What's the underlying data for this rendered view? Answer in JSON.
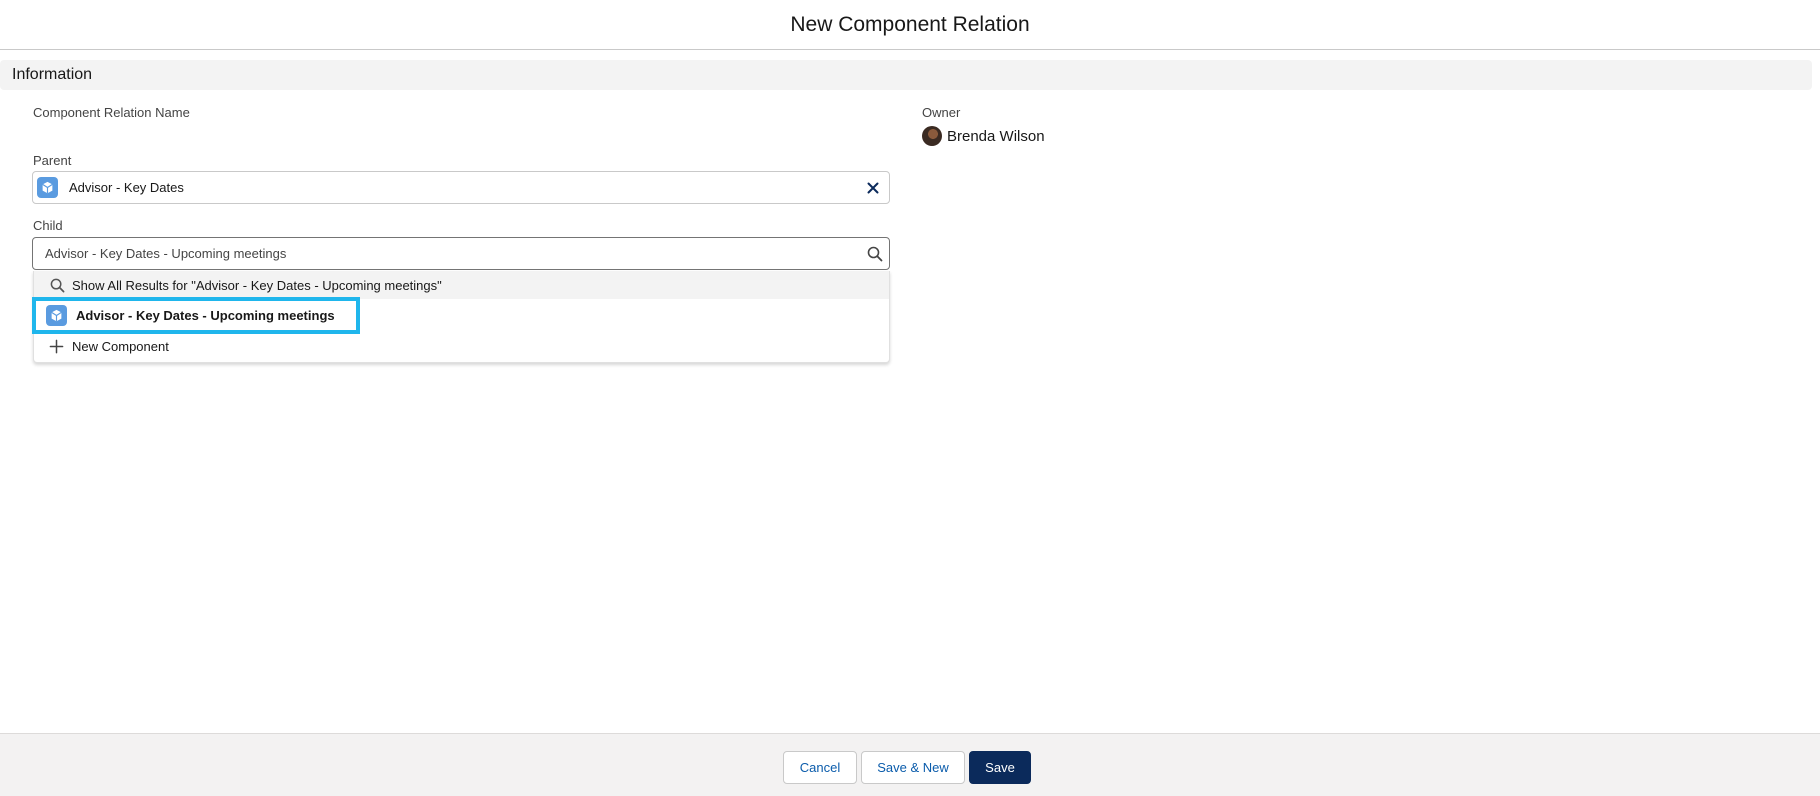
{
  "modal": {
    "title": "New Component Relation"
  },
  "section": {
    "title": "Information"
  },
  "fields": {
    "name": {
      "label": "Component Relation Name"
    },
    "parent": {
      "label": "Parent",
      "value": "Advisor - Key Dates",
      "icon": "component-icon",
      "clear_icon": "close-icon"
    },
    "child": {
      "label": "Child",
      "value": "Advisor - Key Dates - Upcoming meetings",
      "icon": "search-icon"
    },
    "owner": {
      "label": "Owner",
      "value": "Brenda Wilson"
    }
  },
  "dropdown": {
    "show_all": "Show All Results for \"Advisor - Key Dates - Upcoming meetings\"",
    "result": "Advisor - Key Dates - Upcoming meetings",
    "new_record": "New Component"
  },
  "footer": {
    "cancel": "Cancel",
    "save_new": "Save & New",
    "save": "Save"
  },
  "colors": {
    "brand": "#0b2a5b",
    "highlight": "#1fb6ec",
    "object_icon": "#5a9be0"
  }
}
